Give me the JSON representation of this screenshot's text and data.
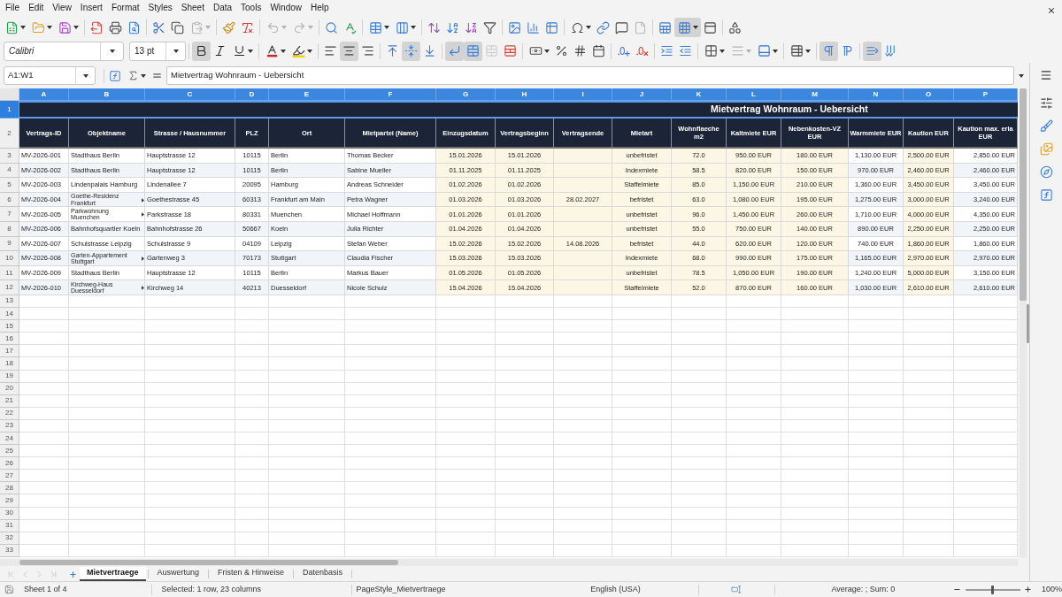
{
  "menu": [
    "File",
    "Edit",
    "View",
    "Insert",
    "Format",
    "Styles",
    "Sheet",
    "Data",
    "Tools",
    "Window",
    "Help"
  ],
  "toolbar_standard": [
    {
      "pressed": false,
      "disabled": false
    },
    {
      "pressed": false,
      "disabled": false
    },
    {
      "pressed": false,
      "disabled": false
    },
    {
      "pressed": false,
      "disabled": false
    },
    {
      "pressed": false,
      "disabled": false
    },
    {
      "pressed": false,
      "disabled": false
    },
    {
      "pressed": false,
      "disabled": false
    },
    {
      "pressed": false,
      "disabled": false
    },
    {
      "pressed": false,
      "disabled": true
    },
    {
      "pressed": false,
      "disabled": false
    },
    {
      "pressed": false,
      "disabled": false
    },
    {
      "pressed": false,
      "disabled": true
    },
    {
      "pressed": false,
      "disabled": true
    },
    {
      "pressed": false,
      "disabled": false
    },
    {
      "pressed": false,
      "disabled": false
    },
    {
      "pressed": false,
      "disabled": false
    },
    {
      "pressed": false,
      "disabled": false
    },
    {
      "pressed": false,
      "disabled": false
    },
    {
      "pressed": false,
      "disabled": false
    },
    {
      "pressed": false,
      "disabled": false
    },
    {
      "pressed": false,
      "disabled": false
    },
    {
      "pressed": false,
      "disabled": false
    },
    {
      "pressed": false,
      "disabled": false
    },
    {
      "pressed": false,
      "disabled": false
    },
    {
      "pressed": false,
      "disabled": false
    },
    {
      "pressed": false,
      "disabled": false
    },
    {
      "pressed": false,
      "disabled": false
    },
    {
      "pressed": false,
      "disabled": true
    },
    {
      "pressed": false,
      "disabled": false
    },
    {
      "pressed": true,
      "disabled": false
    },
    {
      "pressed": false,
      "disabled": false
    },
    {
      "pressed": false,
      "disabled": false
    }
  ],
  "toolbar_formatting": {
    "font_name": "Calibri",
    "font_size": "13 pt",
    "buttons": [
      {
        "pressed": true,
        "disabled": false
      },
      {
        "pressed": false,
        "disabled": false
      },
      {
        "pressed": false,
        "disabled": false
      },
      {
        "pressed": false,
        "disabled": false
      },
      {
        "pressed": false,
        "disabled": false
      },
      {
        "pressed": false,
        "disabled": false
      },
      {
        "pressed": true,
        "disabled": false
      },
      {
        "pressed": false,
        "disabled": false
      },
      {
        "pressed": false,
        "disabled": false
      },
      {
        "pressed": true,
        "disabled": false
      },
      {
        "pressed": false,
        "disabled": false
      },
      {
        "pressed": true,
        "disabled": false
      },
      {
        "pressed": true,
        "disabled": false
      },
      {
        "pressed": false,
        "disabled": true
      },
      {
        "pressed": false,
        "disabled": false
      },
      {
        "pressed": false,
        "disabled": false
      },
      {
        "pressed": false,
        "disabled": false
      },
      {
        "pressed": false,
        "disabled": false
      },
      {
        "pressed": false,
        "disabled": false
      },
      {
        "pressed": false,
        "disabled": false
      },
      {
        "pressed": false,
        "disabled": false
      },
      {
        "pressed": false,
        "disabled": false
      },
      {
        "pressed": false,
        "disabled": false
      },
      {
        "pressed": false,
        "disabled": false
      },
      {
        "pressed": false,
        "disabled": true
      },
      {
        "pressed": false,
        "disabled": false
      },
      {
        "pressed": false,
        "disabled": false
      },
      {
        "pressed": true,
        "disabled": false
      },
      {
        "pressed": false,
        "disabled": false
      },
      {
        "pressed": true,
        "disabled": false
      },
      {
        "pressed": false,
        "disabled": false
      }
    ]
  },
  "formula_bar": {
    "name_box": "A1:W1",
    "formula": "Mietvertrag Wohnraum - Uebersicht"
  },
  "sheet": {
    "columns": [
      {
        "label": "A",
        "selected": true,
        "shaded": false
      },
      {
        "label": "B",
        "selected": true,
        "shaded": false
      },
      {
        "label": "C",
        "selected": true,
        "shaded": false
      },
      {
        "label": "D",
        "selected": true,
        "shaded": false
      },
      {
        "label": "E",
        "selected": true,
        "shaded": false
      },
      {
        "label": "F",
        "selected": true,
        "shaded": false
      },
      {
        "label": "G",
        "selected": true,
        "shaded": true
      },
      {
        "label": "H",
        "selected": true,
        "shaded": true
      },
      {
        "label": "I",
        "selected": true,
        "shaded": true
      },
      {
        "label": "J",
        "selected": true,
        "shaded": true
      },
      {
        "label": "K",
        "selected": true,
        "shaded": true
      },
      {
        "label": "L",
        "selected": true,
        "shaded": true
      },
      {
        "label": "M",
        "selected": true,
        "shaded": true
      },
      {
        "label": "N",
        "selected": true,
        "shaded": false
      },
      {
        "label": "O",
        "selected": true,
        "shaded": true
      },
      {
        "label": "P",
        "selected": true,
        "shaded": false
      }
    ],
    "title_row": {
      "number": "1",
      "selected": true,
      "text": "Mietvertrag Wohnraum - Uebersicht"
    },
    "header_row": {
      "number": "2",
      "selected": false,
      "cells": [
        "Vertrags-ID",
        "Objektname",
        "Strasse / Hausnummer",
        "PLZ",
        "Ort",
        "Mietpartei (Name)",
        "Einzugsdatum",
        "Vertragsbeginn",
        "Vertragsende",
        "Mietart",
        [
          "Wohnflaeche",
          "m2"
        ],
        "Kaltmiete EUR",
        [
          "Nebenkosten-VZ",
          "EUR"
        ],
        "Warmmiete EUR",
        "Kaution EUR",
        [
          "Kaution max. erla",
          "EUR"
        ]
      ]
    },
    "data_rows": [
      {
        "number": "3",
        "selected": false,
        "banded": false,
        "overflow": false,
        "cells": [
          "MV-2026-001",
          "Stadthaus Berlin",
          "Hauptstrasse 12",
          "10115",
          "Berlin",
          "Thomas Becker",
          "15.01.2026",
          "15.01.2026",
          null,
          "unbefristet",
          "72.0",
          "950.00 EUR",
          "180.00 EUR",
          "1,130.00 EUR",
          "2,500.00 EUR",
          "2,850.00 EUR"
        ]
      },
      {
        "number": "4",
        "selected": false,
        "banded": true,
        "overflow": false,
        "cells": [
          "MV-2026-002",
          "Stadthaus Berlin",
          "Hauptstrasse 12",
          "10115",
          "Berlin",
          "Sabine Mueller",
          "01.11.2025",
          "01.11.2025",
          null,
          "Indexmiete",
          "58.5",
          "820.00 EUR",
          "150.00 EUR",
          "970.00 EUR",
          "2,460.00 EUR",
          "2,460.00 EUR"
        ]
      },
      {
        "number": "5",
        "selected": false,
        "banded": false,
        "overflow": false,
        "cells": [
          "MV-2026-003",
          "Lindenpalais Hamburg",
          "Lindenallee 7",
          "20095",
          "Hamburg",
          "Andreas Schneider",
          "01.02.2026",
          "01.02.2026",
          null,
          "Staffelmiete",
          "85.0",
          "1,150.00 EUR",
          "210.00 EUR",
          "1,360.00 EUR",
          "3,450.00 EUR",
          "3,450.00 EUR"
        ]
      },
      {
        "number": "6",
        "selected": false,
        "banded": true,
        "overflow": true,
        "cells": [
          "MV-2026-004",
          [
            "Goethe-Residenz",
            "Frankfurt"
          ],
          "Goethestrasse 45",
          "60313",
          "Frankfurt am Main",
          "Petra Wagner",
          "01.03.2026",
          "01.03.2026",
          "28.02.2027",
          "befristet",
          "63.0",
          "1,080.00 EUR",
          "195.00 EUR",
          "1,275.00 EUR",
          "3,000.00 EUR",
          "3,240.00 EUR"
        ]
      },
      {
        "number": "7",
        "selected": false,
        "banded": false,
        "overflow": true,
        "cells": [
          "MV-2026-005",
          [
            "Parkwohnung",
            "Muenchen"
          ],
          "Parkstrasse 18",
          "80331",
          "Muenchen",
          "Michael Hoffmann",
          "01.01.2026",
          "01.01.2026",
          null,
          "unbefristet",
          "96.0",
          "1,450.00 EUR",
          "260.00 EUR",
          "1,710.00 EUR",
          "4,000.00 EUR",
          "4,350.00 EUR"
        ]
      },
      {
        "number": "8",
        "selected": false,
        "banded": true,
        "overflow": false,
        "cells": [
          "MV-2026-006",
          "Bahnhofsquartier Koeln",
          "Bahnhofstrasse 26",
          "50667",
          "Koeln",
          "Julia Richter",
          "01.04.2026",
          "01.04.2026",
          null,
          "unbefristet",
          "55.0",
          "750.00 EUR",
          "140.00 EUR",
          "890.00 EUR",
          "2,250.00 EUR",
          "2,250.00 EUR"
        ]
      },
      {
        "number": "9",
        "selected": false,
        "banded": false,
        "overflow": false,
        "cells": [
          "MV-2026-007",
          "Schulstrasse Leipzig",
          "Schulstrasse 9",
          "04109",
          "Leipzig",
          "Stefan Weber",
          "15.02.2026",
          "15.02.2026",
          "14.08.2026",
          "befristet",
          "44.0",
          "620.00 EUR",
          "120.00 EUR",
          "740.00 EUR",
          "1,860.00 EUR",
          "1,860.00 EUR"
        ]
      },
      {
        "number": "10",
        "selected": false,
        "banded": true,
        "overflow": true,
        "cells": [
          "MV-2026-008",
          [
            "Garten-Appartement",
            "Stuttgart"
          ],
          "Gartenweg 3",
          "70173",
          "Stuttgart",
          "Claudia Fischer",
          "15.03.2026",
          "15.03.2026",
          null,
          "Indexmiete",
          "68.0",
          "990.00 EUR",
          "175.00 EUR",
          "1,165.00 EUR",
          "2,970.00 EUR",
          "2,970.00 EUR"
        ]
      },
      {
        "number": "11",
        "selected": false,
        "banded": false,
        "overflow": false,
        "cells": [
          "MV-2026-009",
          "Stadthaus Berlin",
          "Hauptstrasse 12",
          "10115",
          "Berlin",
          "Markus Bauer",
          "01.05.2026",
          "01.05.2026",
          null,
          "unbefristet",
          "78.5",
          "1,050.00 EUR",
          "190.00 EUR",
          "1,240.00 EUR",
          "5,000.00 EUR",
          "3,150.00 EUR"
        ]
      },
      {
        "number": "12",
        "selected": false,
        "banded": true,
        "overflow": true,
        "cells": [
          "MV-2026-010",
          [
            "Kirchweg-Haus",
            "Duesseldorf"
          ],
          "Kirchweg 14",
          "40213",
          "Duesseldorf",
          "Nicole Schulz",
          "15.04.2026",
          "15.04.2026",
          null,
          "Staffelmiete",
          "52.0",
          "870.00 EUR",
          "160.00 EUR",
          "1,030.00 EUR",
          "2,610.00 EUR",
          "2,610.00 EUR"
        ]
      }
    ],
    "empty_rows": [
      {
        "number": "13",
        "selected": false
      },
      {
        "number": "14",
        "selected": false
      },
      {
        "number": "15",
        "selected": false
      },
      {
        "number": "16",
        "selected": false
      },
      {
        "number": "17",
        "selected": false
      },
      {
        "number": "18",
        "selected": false
      },
      {
        "number": "19",
        "selected": false
      },
      {
        "number": "20",
        "selected": false
      },
      {
        "number": "21",
        "selected": false
      },
      {
        "number": "22",
        "selected": false
      },
      {
        "number": "23",
        "selected": false
      },
      {
        "number": "24",
        "selected": false
      },
      {
        "number": "25",
        "selected": false
      },
      {
        "number": "26",
        "selected": false
      },
      {
        "number": "27",
        "selected": false
      },
      {
        "number": "28",
        "selected": false
      },
      {
        "number": "29",
        "selected": false
      },
      {
        "number": "30",
        "selected": false
      },
      {
        "number": "31",
        "selected": false
      },
      {
        "number": "32",
        "selected": false
      },
      {
        "number": "33",
        "selected": false
      }
    ]
  },
  "sheet_tabs": {
    "nav_buttons": [
      {
        "disabled": true
      },
      {
        "disabled": true
      },
      {
        "disabled": true
      },
      {
        "disabled": true
      }
    ],
    "tabs": [
      {
        "label": "Mietvertraege",
        "selected": true
      },
      {
        "label": "Auswertung",
        "selected": false
      },
      {
        "label": "Fristen & Hinweise",
        "selected": false
      },
      {
        "label": "Datenbasis",
        "selected": false
      }
    ]
  },
  "status_bar": {
    "sheet": "Sheet 1 of 4",
    "selection": "Selected: 1 row, 23 columns",
    "page_style": "PageStyle_Mietvertraege",
    "language": "English (USA)",
    "summary": "Average: ; Sum: 0",
    "zoom": {
      "level": 0.5,
      "reading": "100%"
    }
  }
}
